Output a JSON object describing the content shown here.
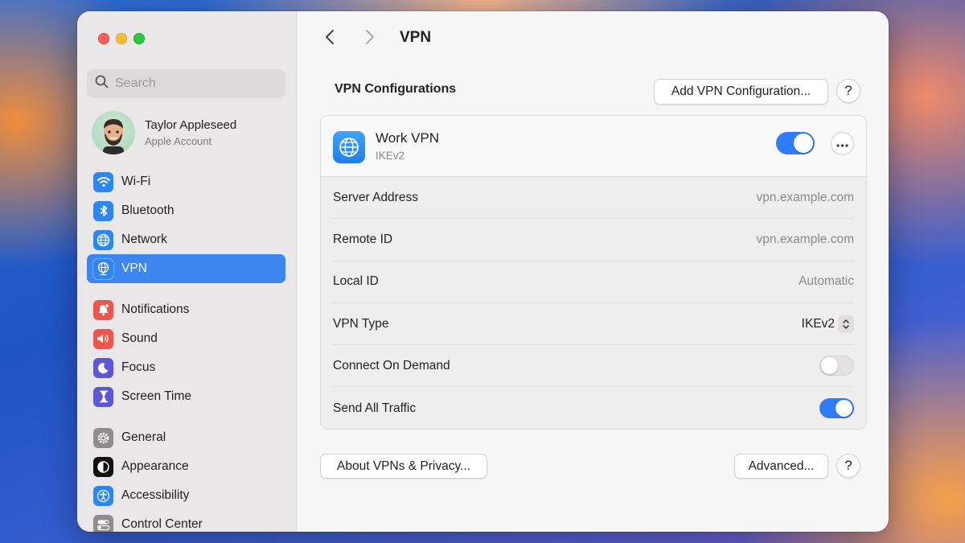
{
  "sidebar": {
    "search_placeholder": "Search",
    "account": {
      "name": "Taylor Appleseed",
      "subtitle": "Apple Account"
    },
    "groups": [
      [
        {
          "label": "Wi-Fi",
          "icon": "wifi-icon",
          "color": "#2e86f0"
        },
        {
          "label": "Bluetooth",
          "icon": "bluetooth-icon",
          "color": "#2e86f0"
        },
        {
          "label": "Network",
          "icon": "globe-icon",
          "color": "#2e86f0"
        },
        {
          "label": "VPN",
          "icon": "vpn-globe-icon",
          "color": "#2e86f0",
          "active": true
        }
      ],
      [
        {
          "label": "Notifications",
          "icon": "bell-icon",
          "color": "#f0554d"
        },
        {
          "label": "Sound",
          "icon": "speaker-icon",
          "color": "#f0554d"
        },
        {
          "label": "Focus",
          "icon": "moon-icon",
          "color": "#5b57d6"
        },
        {
          "label": "Screen Time",
          "icon": "hourglass-icon",
          "color": "#5b57d6"
        }
      ],
      [
        {
          "label": "General",
          "icon": "gear-icon",
          "color": "#8e8c8d"
        },
        {
          "label": "Appearance",
          "icon": "appearance-icon",
          "color": "#111111"
        },
        {
          "label": "Accessibility",
          "icon": "accessibility-icon",
          "color": "#2e86f0"
        },
        {
          "label": "Control Center",
          "icon": "control-center-icon",
          "color": "#8e8c8d"
        }
      ]
    ]
  },
  "main": {
    "title": "VPN",
    "section_title": "VPN Configurations",
    "add_button": "Add VPN Configuration...",
    "help_label": "?",
    "vpn": {
      "name": "Work VPN",
      "type": "IKEv2",
      "enabled": true
    },
    "rows": {
      "server_address": {
        "label": "Server Address",
        "value": "vpn.example.com"
      },
      "remote_id": {
        "label": "Remote ID",
        "value": "vpn.example.com"
      },
      "local_id": {
        "label": "Local ID",
        "value": "Automatic"
      },
      "vpn_type": {
        "label": "VPN Type",
        "value": "IKEv2"
      },
      "connect_on_demand": {
        "label": "Connect On Demand",
        "on": false
      },
      "send_all_traffic": {
        "label": "Send All Traffic",
        "on": true
      }
    },
    "about_button": "About VPNs & Privacy...",
    "advanced_button": "Advanced..."
  },
  "colors": {
    "accent": "#2f7cf6",
    "selection": "#3d86f0"
  }
}
